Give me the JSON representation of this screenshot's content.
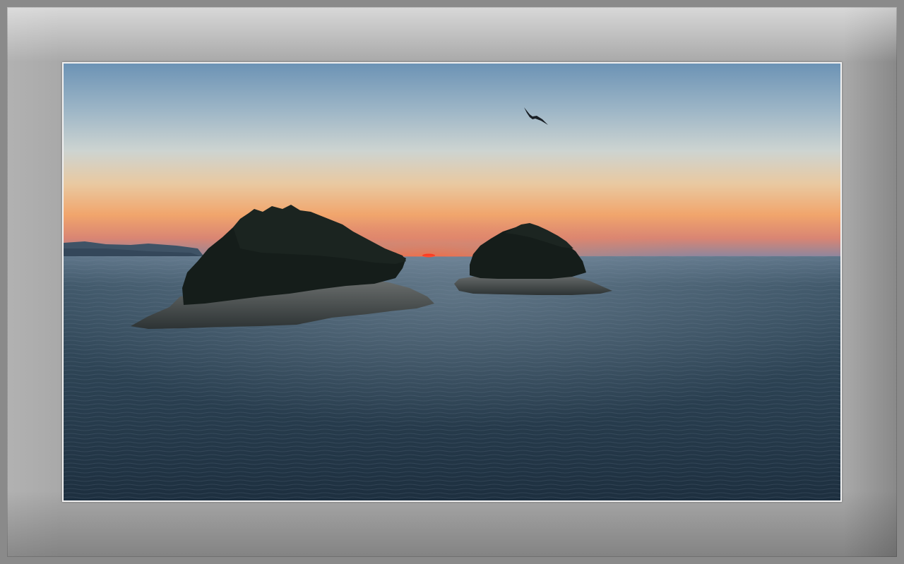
{
  "scene": {
    "subject": "",
    "colors": {
      "frame_outer": "#8a8a8a",
      "mat": "#a9a9a9",
      "photo_border": "#f2f2f2",
      "sky_top": "#6f95b6",
      "sky_mid": "#c9d3d4",
      "sky_glow": "#f0a36a",
      "horizon": "#e3564a",
      "sea": "#2f4556",
      "island": "#17201c"
    }
  }
}
